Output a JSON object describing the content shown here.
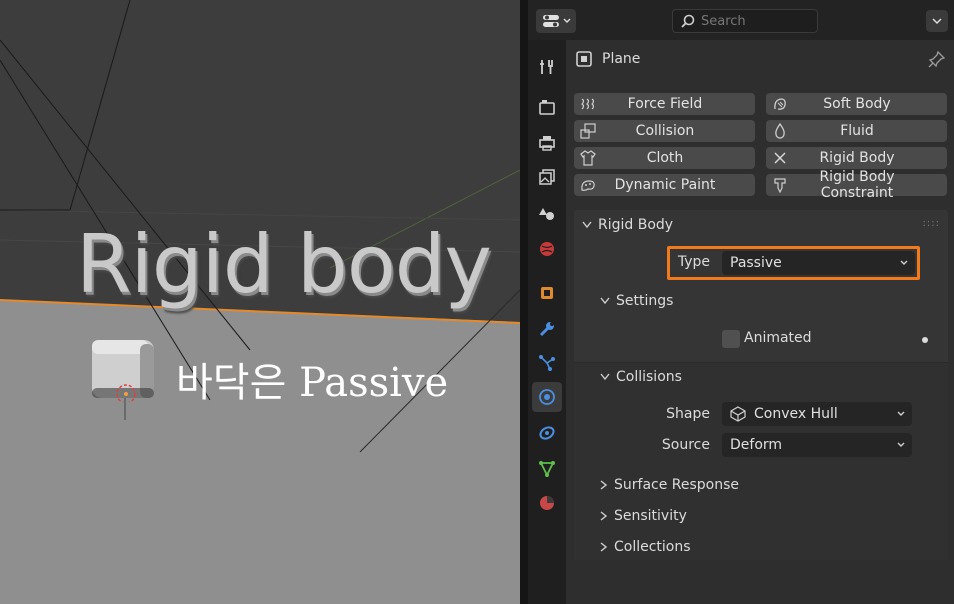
{
  "viewport": {
    "title_text": "Rigid body",
    "caption_text": "바닥은 Passive"
  },
  "header": {
    "search_placeholder": "Search"
  },
  "properties": {
    "object_name": "Plane",
    "physics_buttons": [
      {
        "label": "Force Field",
        "icon": "force-field-icon"
      },
      {
        "label": "Soft Body",
        "icon": "soft-body-icon"
      },
      {
        "label": "Collision",
        "icon": "collision-icon"
      },
      {
        "label": "Fluid",
        "icon": "fluid-icon"
      },
      {
        "label": "Cloth",
        "icon": "cloth-icon"
      },
      {
        "label": "Rigid Body",
        "icon": "remove-x-icon"
      },
      {
        "label": "Dynamic Paint",
        "icon": "dynamic-paint-icon"
      },
      {
        "label": "Rigid Body Constraint",
        "icon": "rigid-body-constraint-icon"
      }
    ],
    "rigid_body": {
      "panel_title": "Rigid Body",
      "type_label": "Type",
      "type_value": "Passive",
      "settings_title": "Settings",
      "animated_label": "Animated",
      "animated_checked": false,
      "collisions_title": "Collisions",
      "shape_label": "Shape",
      "shape_value": "Convex Hull",
      "source_label": "Source",
      "source_value": "Deform",
      "surface_response_title": "Surface Response",
      "sensitivity_title": "Sensitivity",
      "collections_title": "Collections"
    }
  },
  "colors": {
    "highlight": "#f07a1c",
    "accent_blue": "#4a8fe0"
  }
}
